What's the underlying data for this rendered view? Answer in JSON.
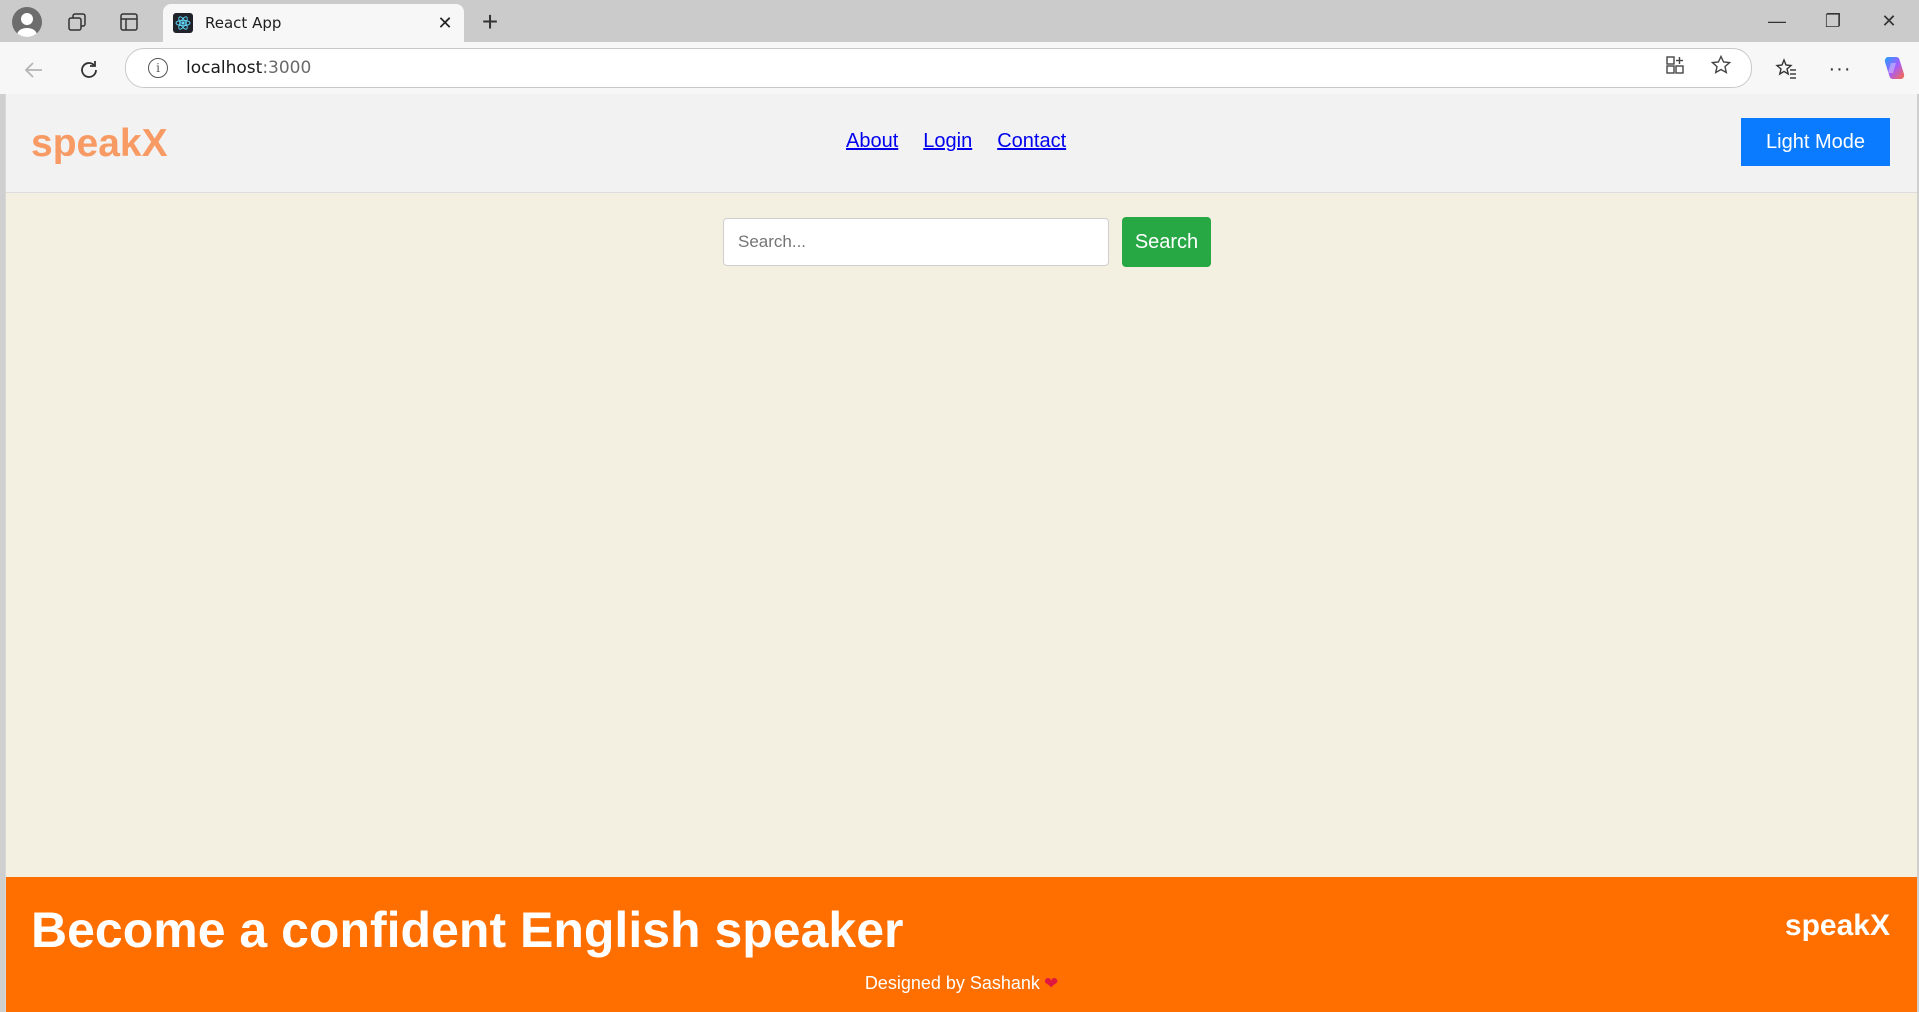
{
  "browser": {
    "tab_title": "React App",
    "tab_close": "✕",
    "new_tab": "+",
    "url_host": "localhost",
    "url_port": ":3000",
    "window_controls": [
      "—",
      "❐",
      "✕"
    ]
  },
  "navbar": {
    "brand": "speakX",
    "links": [
      "About",
      "Login",
      "Contact"
    ],
    "mode_button": "Light Mode"
  },
  "search": {
    "placeholder": "Search...",
    "button": "Search"
  },
  "footer": {
    "tagline": "Become a confident English speaker",
    "brand": "speakX",
    "credit": "Designed by Sashank",
    "heart": "❤"
  },
  "colors": {
    "brand": "#f89a63",
    "mode_button": "#0a7bff",
    "search_button": "#28a745",
    "footer_bg": "#ff6f00",
    "page_bg": "#f3f0e2"
  },
  "icons": [
    "profile-icon",
    "workspaces-icon",
    "tab-actions-icon",
    "react-favicon",
    "back-arrow-icon",
    "refresh-icon",
    "info-icon",
    "app-available-icon",
    "favorite-star-icon",
    "favorites-icon",
    "more-icon",
    "copilot-icon"
  ]
}
